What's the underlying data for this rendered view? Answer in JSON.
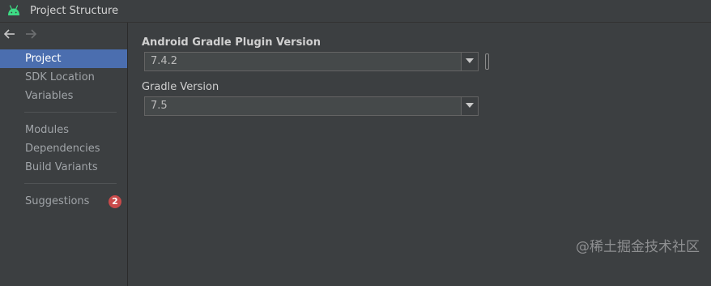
{
  "window": {
    "title": "Project Structure"
  },
  "sidebar": {
    "items": [
      {
        "label": "Project",
        "selected": true
      },
      {
        "label": "SDK Location"
      },
      {
        "label": "Variables"
      },
      {
        "label": "Modules"
      },
      {
        "label": "Dependencies"
      },
      {
        "label": "Build Variants"
      },
      {
        "label": "Suggestions",
        "badge": "2"
      }
    ]
  },
  "main": {
    "agp_label": "Android Gradle Plugin Version",
    "agp_value": "7.4.2",
    "gradle_label": "Gradle Version",
    "gradle_value": "7.5"
  },
  "watermark": "@稀土掘金技术社区",
  "colors": {
    "background": "#3c3f41",
    "selection": "#4b6eaf",
    "badge": "#c94a4a",
    "android_green": "#3ddc84"
  }
}
